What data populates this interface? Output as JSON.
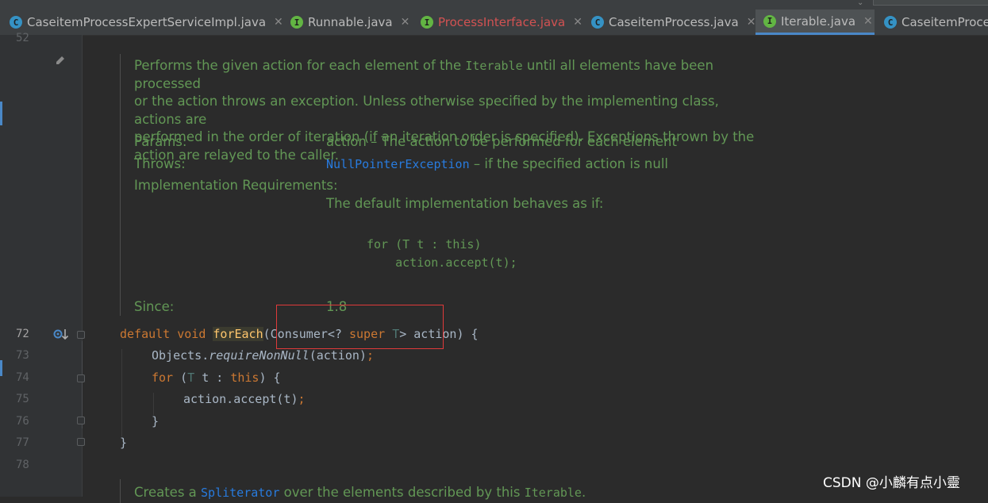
{
  "tabs": [
    {
      "label": "CaseitemProcessExpertServiceImpl.java",
      "icon": "C",
      "kind": "class",
      "closable": true,
      "active": false,
      "error": false
    },
    {
      "label": "Runnable.java",
      "icon": "I",
      "kind": "interface",
      "closable": true,
      "active": false,
      "error": false
    },
    {
      "label": "ProcessInterface.java",
      "icon": "I",
      "kind": "interface",
      "closable": true,
      "active": false,
      "error": true
    },
    {
      "label": "CaseitemProcess.java",
      "icon": "C",
      "kind": "class",
      "closable": true,
      "active": false,
      "error": false
    },
    {
      "label": "Iterable.java",
      "icon": "I",
      "kind": "interface",
      "closable": true,
      "active": true,
      "error": false
    },
    {
      "label": "CaseitemProce",
      "icon": "C",
      "kind": "class",
      "closable": false,
      "active": false,
      "error": false
    }
  ],
  "gutter": {
    "top_line": "52",
    "lines": [
      "72",
      "73",
      "74",
      "75",
      "76",
      "77",
      "78"
    ],
    "current_line": "72"
  },
  "doc": {
    "desc_1": "Performs the given action for each element of the ",
    "desc_code": "Iterable",
    "desc_2": " until all elements have been processed",
    "desc_3": "or the action throws an exception. Unless otherwise specified by the implementing class, actions are",
    "desc_4": "performed in the order of iteration (if an iteration order is specified). Exceptions thrown by the",
    "desc_5": "action are relayed to the caller.",
    "params_label": "Params:",
    "params_value": "action – The action to be performed for each element",
    "throws_label": "Throws:",
    "throws_link": "NullPointerException",
    "throws_rest": " – if the specified action is null",
    "impl_label": "Implementation Requirements:",
    "impl_text": "The default implementation behaves as if:",
    "impl_code_1": "for (T t : this)",
    "impl_code_2": "    action.accept(t);",
    "since_label": "Since:",
    "since_value": "1.8"
  },
  "code": {
    "l72_kw": "default void ",
    "l72_fn": "forEach",
    "l72_a": "(Consumer<? ",
    "l72_super": "super",
    "l72_sp": " ",
    "l72_t": "T",
    "l72_b": "> action) {",
    "l73_a": "Objects.",
    "l73_it": "requireNonNull",
    "l73_b": "(action)",
    "l73_semi": ";",
    "l74_for": "for",
    "l74_a": " (",
    "l74_t": "T",
    "l74_b": " t : ",
    "l74_this": "this",
    "l74_c": ") {",
    "l75_a": "action.accept(t)",
    "l75_semi": ";",
    "l76": "}",
    "l77": "}"
  },
  "next_doc": {
    "text_1": "Creates a ",
    "link": "Spliterator",
    "text_2": " over the elements described by this ",
    "code": "Iterable",
    "text_3": "."
  },
  "watermark": "CSDN @小麟有点小靈",
  "colors": {
    "editor_bg": "#2b2b2b",
    "doc_green": "#629755",
    "keyword": "#cc7832",
    "function": "#ffc66d",
    "highlight_box": "#e03a3a"
  }
}
